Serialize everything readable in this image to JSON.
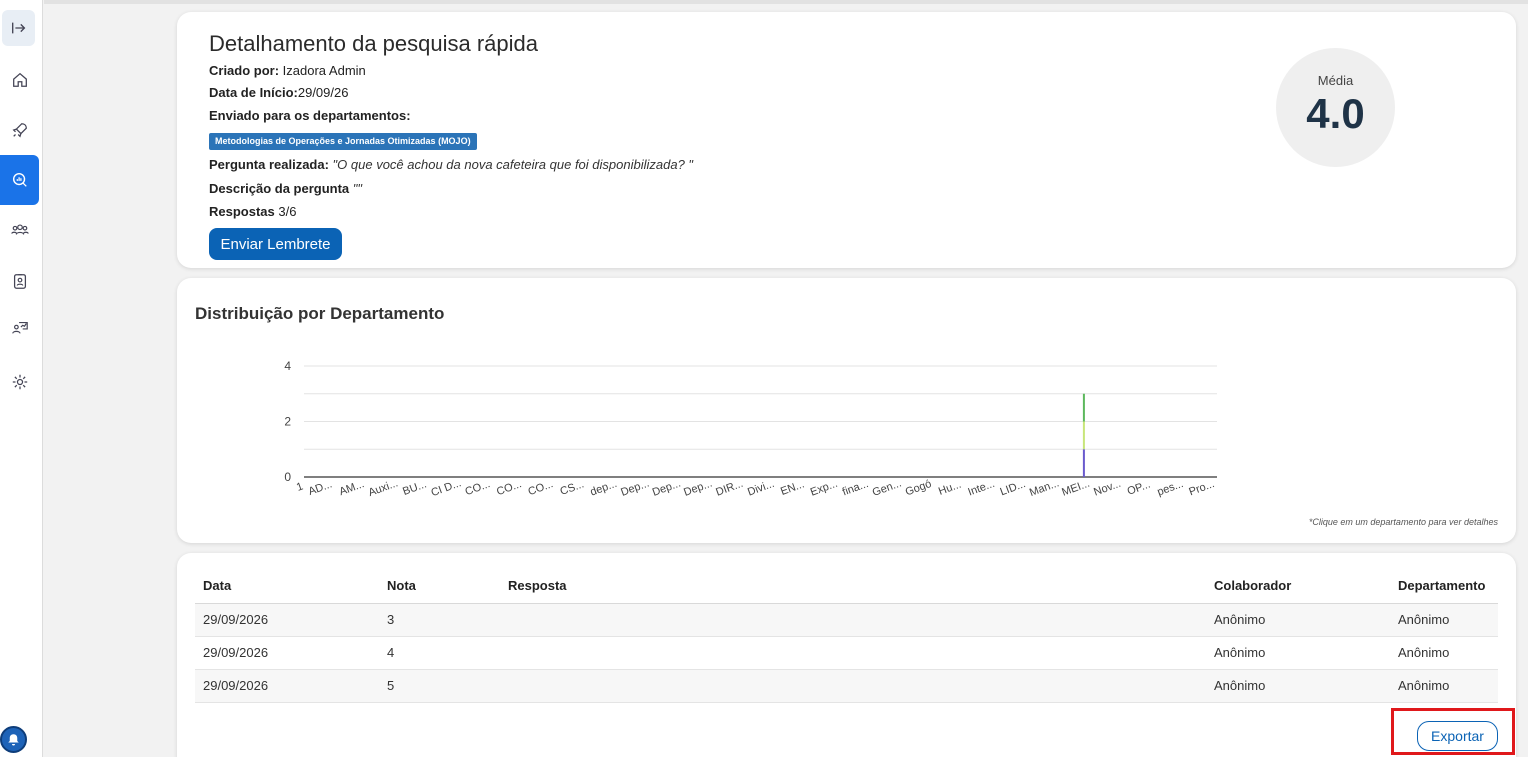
{
  "survey": {
    "title": "Detalhamento da pesquisa rápida",
    "created_by_label": "Criado por:",
    "created_by": " Izadora Admin",
    "start_date_label": "Data de Início:",
    "start_date": "29/09/26",
    "sent_to_label": "Enviado para os departamentos:",
    "department_tag": "Metodologias de Operações e Jornadas Otimizadas (MOJO)",
    "question_label": "Pergunta realizada:",
    "question": " \"O que você achou da nova cafeteira que foi disponibilizada? \"",
    "description_label": "Descrição da pergunta",
    "description": " \"\"",
    "responses_label": "Respostas",
    "responses": " 3/6",
    "remind_button": "Enviar Lembrete",
    "average_label": "Média",
    "average_value": "4.0"
  },
  "chart_data": {
    "type": "bar",
    "title": "Distribuição por Departamento",
    "note": "*Clique em um departamento para ver detalhes",
    "ylim": [
      0,
      4
    ],
    "yticks": [
      "0",
      "2",
      "4"
    ],
    "first_label": "1",
    "categories": [
      "AD...",
      "AM...",
      "Auxi...",
      "BU...",
      "CI D...",
      "CO...",
      "CO...",
      "CO...",
      "CS...",
      "dep...",
      "Dep...",
      "Dep...",
      "Dep...",
      "DIR...",
      "Divi...",
      "EN...",
      "Exp...",
      "fina...",
      "Gen...",
      "Gogó",
      "Hu...",
      "Inte...",
      "LID...",
      "Man...",
      "MEI...",
      "Nov...",
      "OP...",
      "pes...",
      "Pro..."
    ],
    "stacked_series_at": "MEI...",
    "series": [
      {
        "color": "#6a5acd",
        "values_at_category": 1
      },
      {
        "color": "#c8e67a",
        "values_at_category": 1
      },
      {
        "color": "#5cb85c",
        "values_at_category": 1
      }
    ]
  },
  "table": {
    "headers": [
      "Data",
      "Nota",
      "Resposta",
      "Colaborador",
      "Departamento"
    ],
    "rows": [
      [
        "29/09/2026",
        "3",
        "",
        "Anônimo",
        "Anônimo"
      ],
      [
        "29/09/2026",
        "4",
        "",
        "Anônimo",
        "Anônimo"
      ],
      [
        "29/09/2026",
        "5",
        "",
        "Anônimo",
        "Anônimo"
      ]
    ]
  },
  "export_button": "Exportar",
  "icons": {
    "sidebar": [
      "expand-icon",
      "home-icon",
      "rocket-icon",
      "search-chart-icon",
      "team-icon",
      "badge-icon",
      "feedback-icon",
      "settings-icon"
    ],
    "bell": "bell-icon"
  },
  "colors": {
    "accent": "#0b63b5",
    "tag": "#2b74b8",
    "active_sidebar": "#1a73e8",
    "highlight": "#e0181b"
  }
}
